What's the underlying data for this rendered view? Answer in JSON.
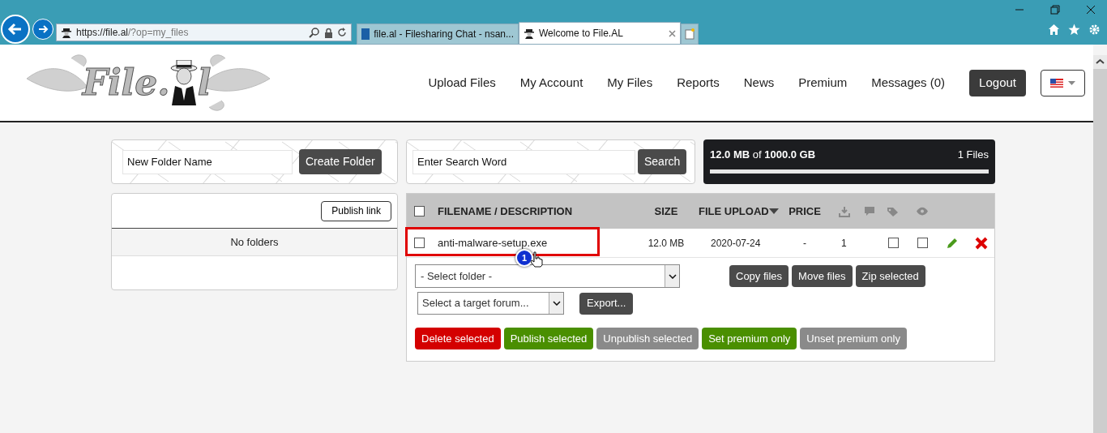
{
  "browser": {
    "address_host": "https://file.al",
    "address_path": "/?op=my_files",
    "tabs": [
      {
        "title": "file.al - Filesharing Chat - nsan...",
        "selected": false,
        "kind": "n"
      },
      {
        "title": "Welcome to File.AL",
        "selected": true,
        "kind": "site"
      }
    ]
  },
  "logo": {
    "left": "File.",
    "right": "l"
  },
  "nav": {
    "items": [
      "Upload Files",
      "My Account",
      "My Files",
      "Reports",
      "News",
      "Premium",
      "Messages (0)"
    ],
    "logout": "Logout"
  },
  "folder_form": {
    "value": "New Folder Name",
    "button": "Create Folder"
  },
  "search_form": {
    "value": "Enter Search Word",
    "button": "Search"
  },
  "storage": {
    "used": "**12.0 MB** of **1000.0 GB**",
    "files": "1 Files"
  },
  "folders": {
    "publish_link": "Publish link",
    "empty": "No folders"
  },
  "table": {
    "select_all": false,
    "columns": [
      "FILENAME / DESCRIPTION",
      "SIZE",
      "FILE UPLOAD",
      "PRICE"
    ],
    "rows": [
      {
        "selected": false,
        "highlighted": true,
        "name": "anti-malware-setup.exe",
        "size": "12.0 MB",
        "upload": "2020-07-24",
        "price": "-",
        "downloads": "1",
        "flags": [
          {
            "checked": false
          },
          {
            "checked": false
          }
        ]
      }
    ]
  },
  "callout": "1",
  "actions": {
    "select_folder": "- Select folder -",
    "folder_buttons": [
      "Copy files",
      "Move files",
      "Zip selected"
    ],
    "forum_select": "Select a target forum...",
    "export": "Export...",
    "bulk_buttons": [
      {
        "label": "Delete selected",
        "kind": "danger"
      },
      {
        "label": "Publish selected",
        "kind": "success"
      },
      {
        "label": "Unpublish selected",
        "kind": "muted"
      },
      {
        "label": "Set premium only",
        "kind": "success"
      },
      {
        "label": "Unset premium only",
        "kind": "muted"
      }
    ]
  }
}
